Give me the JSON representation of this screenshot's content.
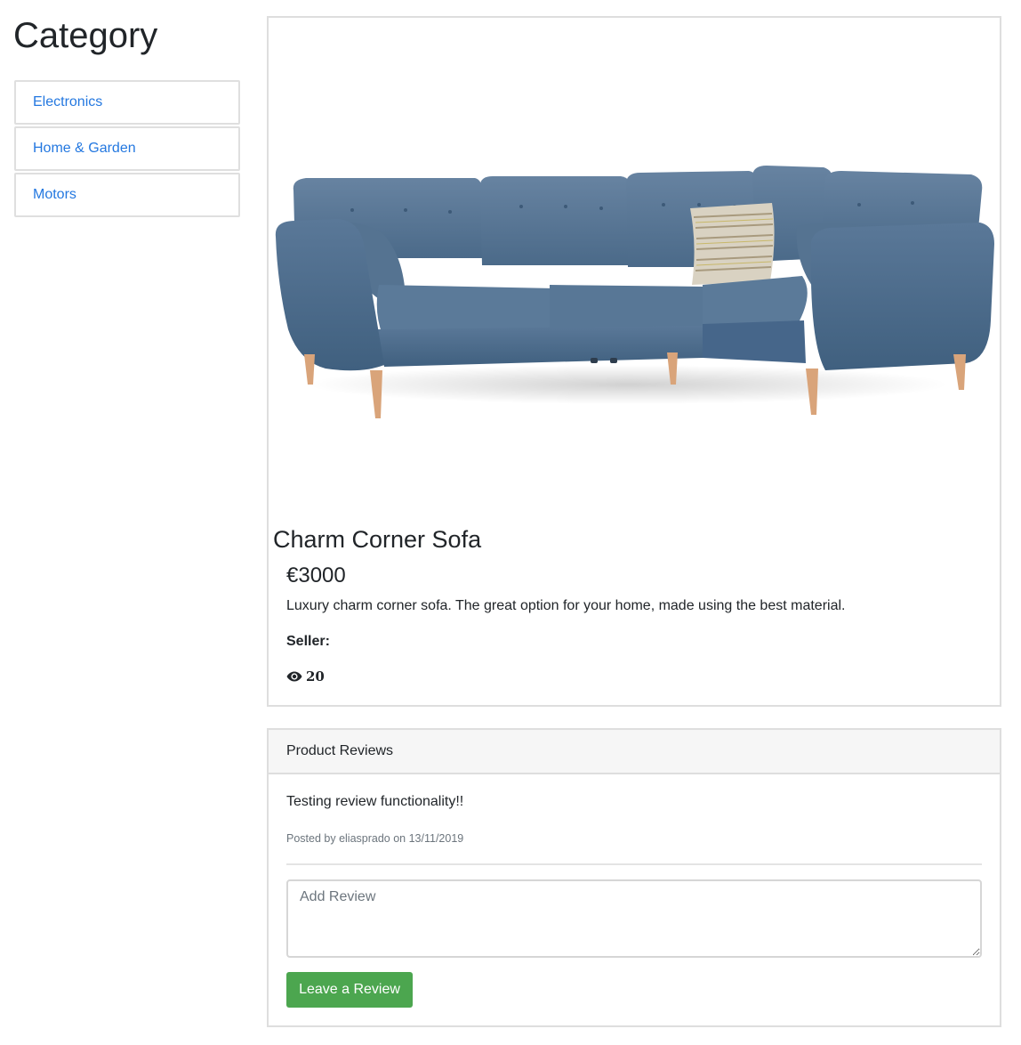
{
  "sidebar": {
    "title": "Category",
    "items": [
      {
        "label": "Electronics"
      },
      {
        "label": "Home & Garden"
      },
      {
        "label": "Motors"
      }
    ]
  },
  "product": {
    "title": "Charm Corner Sofa",
    "price": "€3000",
    "description": "Luxury charm corner sofa. The great option for your home, made using the best material.",
    "seller_label": "Seller:",
    "views_icon": "eye-icon",
    "views": "20"
  },
  "reviews": {
    "header": "Product Reviews",
    "items": [
      {
        "text": "Testing review functionality!!",
        "meta": "Posted by eliasprado on 13/11/2019"
      }
    ],
    "input_placeholder": "Add Review",
    "submit_label": "Leave a Review"
  },
  "colors": {
    "link": "#2478e0",
    "button": "#4ca64f",
    "sofa": "#4e6d8c"
  }
}
